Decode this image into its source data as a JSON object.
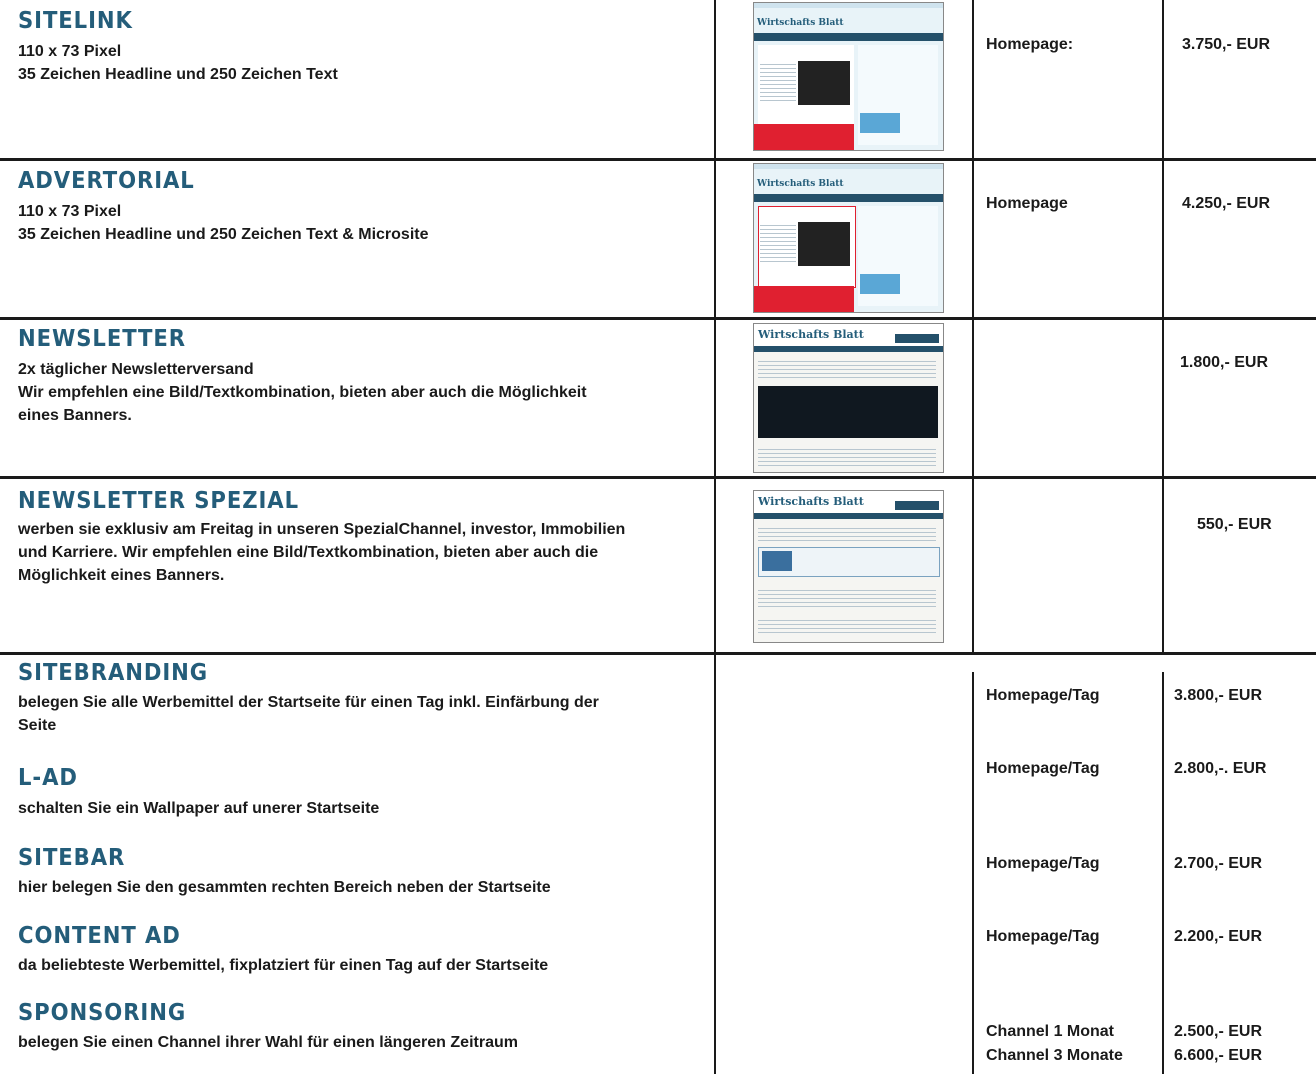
{
  "sections": [
    {
      "title": "SITELINK",
      "lines": [
        "110 x 73 Pixel",
        "35 Zeichen Headline und 250 Zeichen Text"
      ],
      "placement": "Homepage:",
      "price": "3.750,- EUR"
    },
    {
      "title": "ADVERTORIAL",
      "lines": [
        "110 x 73 Pixel",
        "35 Zeichen Headline und 250 Zeichen Text & Microsite"
      ],
      "placement": "Homepage",
      "price": "4.250,- EUR"
    },
    {
      "title": "NEWSLETTER",
      "lines": [
        "2x täglicher Newsletterversand",
        "Wir empfehlen eine Bild/Textkombination, bieten aber auch die Möglichkeit",
        "eines Banners."
      ],
      "placement": "",
      "price": "1.800,- EUR"
    },
    {
      "title": "NEWSLETTER SPEZIAL",
      "lines": [
        "werben sie exklusiv am Freitag in unseren SpezialChannel, investor, Immobilien",
        "und Karriere. Wir empfehlen eine Bild/Textkombination, bieten aber auch die",
        "Möglichkeit eines Banners."
      ],
      "placement": "",
      "price": "550,- EUR"
    },
    {
      "title": "SITEBRANDING",
      "lines": [
        "belegen Sie alle Werbemittel der Startseite für einen Tag inkl. Einfärbung der",
        "Seite"
      ],
      "placement": "Homepage/Tag",
      "price": "3.800,- EUR"
    },
    {
      "title": "L-AD",
      "lines": [
        "schalten Sie ein Wallpaper auf unerer Startseite"
      ],
      "placement": "Homepage/Tag",
      "price": "2.800,-. EUR"
    },
    {
      "title": "SITEBAR",
      "lines": [
        "hier belegen Sie den gesammten rechten Bereich neben der Startseite"
      ],
      "placement": "Homepage/Tag",
      "price": "2.700,- EUR"
    },
    {
      "title": "CONTENT AD",
      "lines": [
        "da beliebteste Werbemittel, fixplatziert für einen Tag auf der Startseite"
      ],
      "placement": "Homepage/Tag",
      "price": "2.200,- EUR"
    },
    {
      "title": "SPONSORING",
      "lines": [
        "belegen Sie einen Channel ihrer Wahl für einen längeren Zeitraum"
      ],
      "placement": "Channel 1 Monat",
      "placement2": "Channel 3 Monate",
      "price": "2.500,- EUR",
      "price2": "6.600,- EUR"
    }
  ],
  "thumbnails": [
    "homepage-screenshot",
    "homepage-advertorial-screenshot",
    "newsletter-screenshot",
    "newsletter-spezial-screenshot"
  ],
  "colors": {
    "title": "#245d7a",
    "rules": "#1a1a1a",
    "ad_red": "#e02030"
  }
}
